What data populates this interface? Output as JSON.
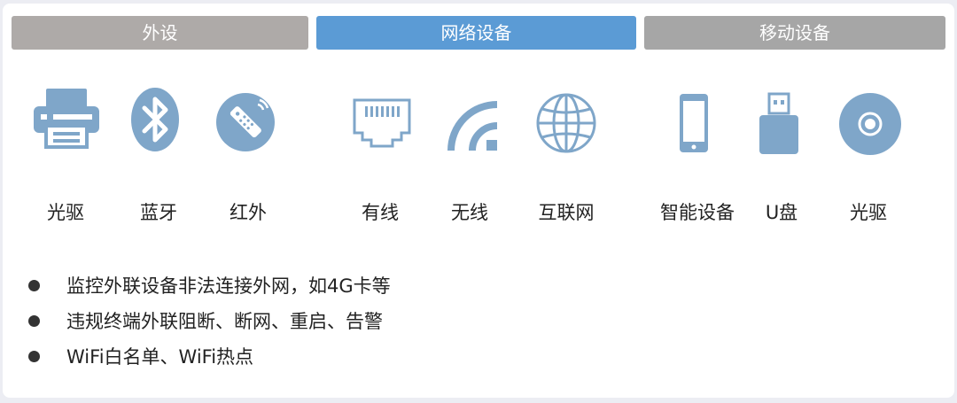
{
  "tabs": [
    {
      "label": "外设"
    },
    {
      "label": "网络设备"
    },
    {
      "label": "移动设备"
    }
  ],
  "devices": [
    {
      "label": "光驱",
      "icon": "printer-icon"
    },
    {
      "label": "蓝牙",
      "icon": "bluetooth-icon"
    },
    {
      "label": "红外",
      "icon": "remote-control-icon"
    },
    {
      "label": "有线",
      "icon": "ethernet-port-icon"
    },
    {
      "label": "无线",
      "icon": "wifi-icon"
    },
    {
      "label": "互联网",
      "icon": "globe-icon"
    },
    {
      "label": "智能设备",
      "icon": "smartphone-icon"
    },
    {
      "label": "U盘",
      "icon": "usb-drive-icon"
    },
    {
      "label": "光驱",
      "icon": "optical-disc-icon"
    }
  ],
  "bullets": [
    {
      "text": "监控外联设备非法连接外网，如4G卡等"
    },
    {
      "text": "违规终端外联阻断、断网、重启、告警"
    },
    {
      "text": "WiFi白名单、WiFi热点"
    }
  ],
  "colors": {
    "icon": "#7fa6c9",
    "tab_peripheral": "#aeaaa8",
    "tab_network": "#5b9bd5",
    "tab_mobile": "#a6a6a6"
  }
}
